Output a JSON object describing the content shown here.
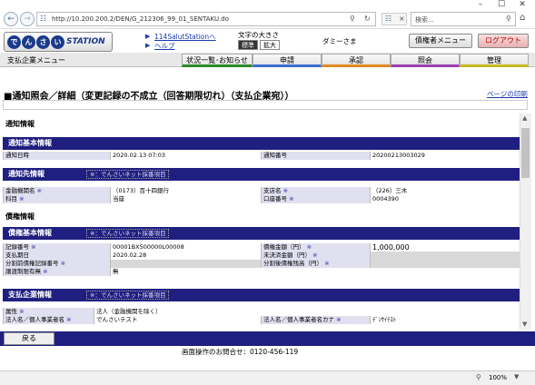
{
  "browser": {
    "url": "http://10.200.200.2/DEN/G_212306_99_01_SENTAKU.do",
    "search_placeholder": "検索...",
    "zoom": "100%"
  },
  "header": {
    "logo_chars": [
      "で",
      "ん",
      "さ",
      "い"
    ],
    "logo_station": "STATION",
    "link1": "114SalutStationへ",
    "link2": "ヘルプ",
    "fontsize_label": "文字の大きさ",
    "fontsize_std": "標準",
    "fontsize_large": "拡大",
    "username": "ダミーさま",
    "creditor_menu": "債権者メニュー",
    "logout": "ログアウト"
  },
  "menu": {
    "label": "支払企業メニュー",
    "tabs": [
      {
        "label": "状況一覧･お知らせ",
        "color": "#2a8a2a"
      },
      {
        "label": "申請",
        "color": "#3a6fd0"
      },
      {
        "label": "承認",
        "color": "#e08a20"
      },
      {
        "label": "照会",
        "color": "#9a40b0"
      },
      {
        "label": "管理",
        "color": "#c8b820"
      }
    ]
  },
  "page": {
    "title": "■通知照会／詳細（変更記録の不成立（回答期限切れ）（支払企業宛））",
    "print_link": "ページの印刷"
  },
  "sections": {
    "notice_info": "通知情報",
    "notice_basic": "通知基本情報",
    "notice_to": "通知先情報",
    "badge": "※：でんさいネット採番項目",
    "claim_info": "債権情報",
    "claim_basic": "債権基本情報",
    "payer_info": "支払企業情報"
  },
  "notice_basic": {
    "date_label": "通知日時",
    "date_value": "2020.02.13 07:03",
    "no_label": "通知番号",
    "no_value": "20200213003029"
  },
  "notice_to": {
    "bank_label": "金融機関名",
    "bank_value": "（0173）百十四銀行",
    "branch_label": "支店名",
    "branch_value": "（226）三木",
    "subject_label": "科目",
    "subject_value": "当座",
    "account_label": "口座番号",
    "account_value": "0004390"
  },
  "claim_basic": {
    "record_label": "記録番号",
    "record_value": "00001BX500000L00008",
    "amount_label": "債権金額（円）",
    "amount_value": "1,000,000",
    "due_label": "支払期日",
    "due_value": "2020.02.28",
    "unsettled_label": "未決済金額（円）",
    "unsettled_value": "",
    "split_label": "分割前債権記録番号",
    "split_value": "",
    "split_remain_label": "分割後債権残高（円）",
    "split_remain_value": "",
    "transfer_label": "譲渡制限有無",
    "transfer_value": "無"
  },
  "payer": {
    "type_label": "属性",
    "type_value": "法人（金融機関を除く）",
    "name_label": "法人名／個人事業者名",
    "name_value": "でんさいテスト",
    "kana_label": "法人名／個人事業者名カナ",
    "kana_value": "ﾃﾞﾝｻｲﾃｽﾄ"
  },
  "footer": {
    "back": "戻る",
    "contact": "画面操作のお問合せ：0120-456-119"
  },
  "ast": "※"
}
